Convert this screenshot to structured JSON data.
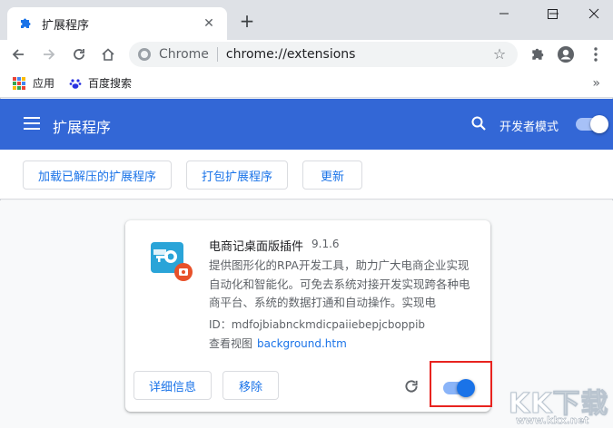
{
  "browser": {
    "tab_title": "扩展程序",
    "omnibox_site": "Chrome",
    "omnibox_url": "chrome://extensions"
  },
  "bookmarks": [
    {
      "label": "应用",
      "icon": "apps-grid-icon"
    },
    {
      "label": "百度搜索",
      "icon": "baidu-paw-icon"
    }
  ],
  "header": {
    "title": "扩展程序",
    "dev_mode_label": "开发者模式",
    "dev_mode_on": true
  },
  "dev_toolbar": {
    "load_unpacked": "加载已解压的扩展程序",
    "pack": "打包扩展程序",
    "update": "更新"
  },
  "extension": {
    "name": "电商记桌面版插件",
    "version": "9.1.6",
    "description": "提供图形化的RPA开发工具，助力广大电商企业实现自动化和智能化。可免去系统对接开发实现跨各种电商平台、系统的数据打通和自动操作。实现电",
    "id_label": "ID：",
    "id": "mdfojbiabnckmdicpaiiebepjcboppib",
    "views_label": "查看视图",
    "views_link": "background.htm",
    "details_button": "详细信息",
    "remove_button": "移除",
    "enabled": true
  },
  "watermark": {
    "main": "KK下载",
    "sub": "www.kkx.net"
  },
  "colors": {
    "header_blue": "#3367d6",
    "link_blue": "#1a73e8",
    "highlight_red": "#e8231f"
  }
}
